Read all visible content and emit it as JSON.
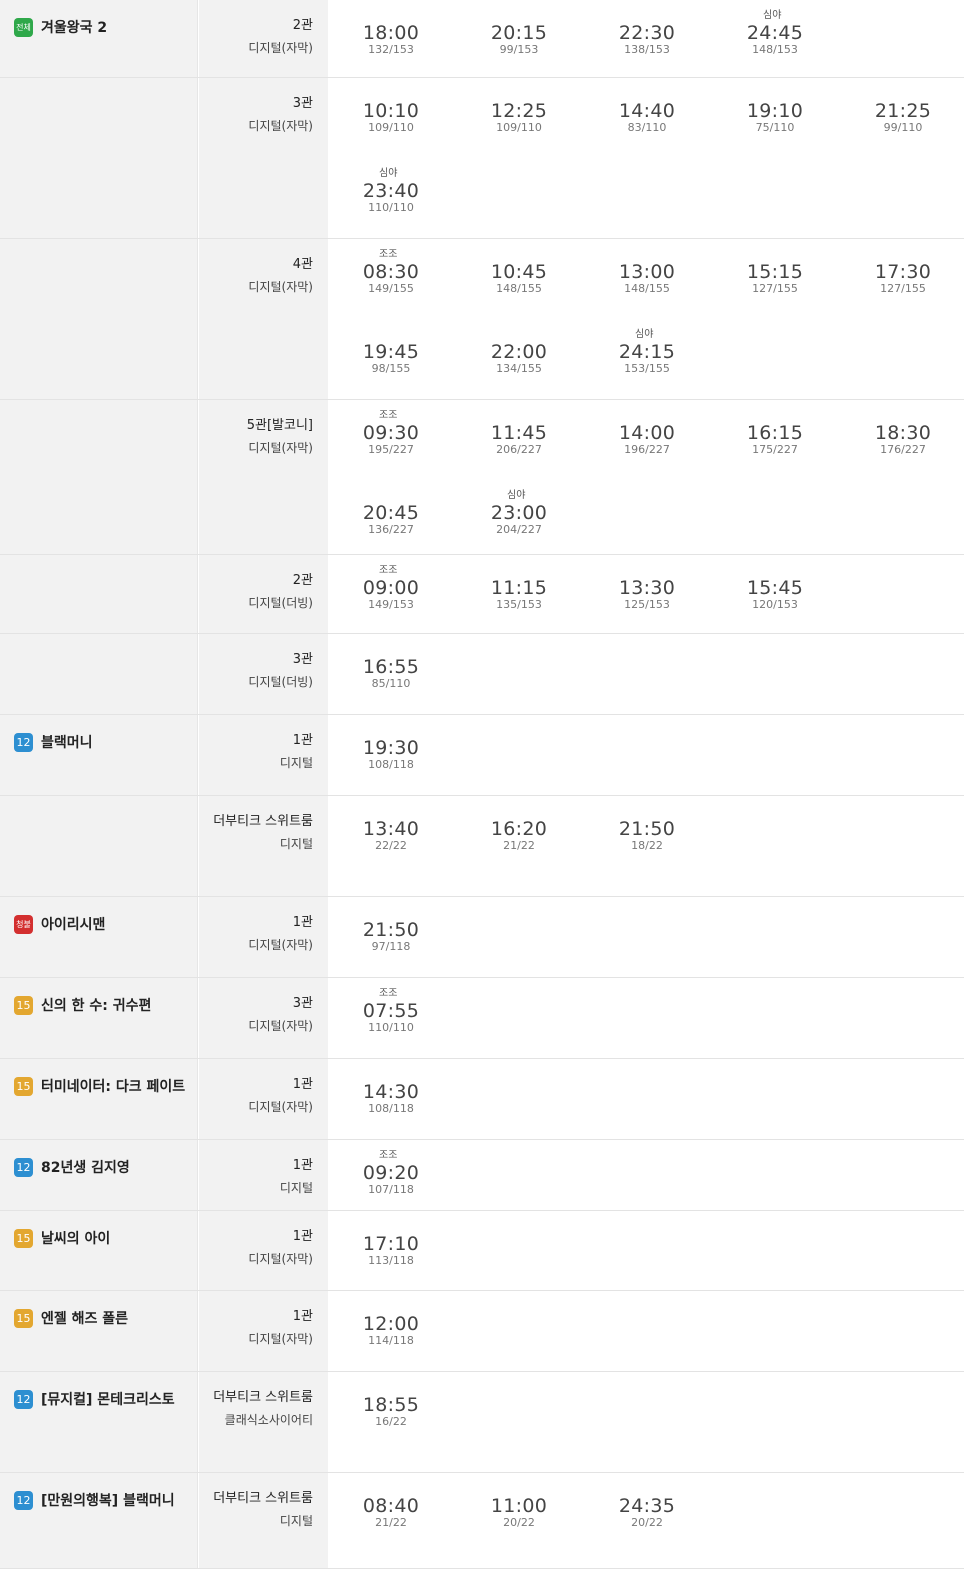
{
  "rows": [
    {
      "movie": "겨울왕국 2",
      "rating": "전체",
      "rating_class": "all",
      "hall": "2관",
      "format": "디지털(자막)",
      "times": [
        {
          "tag": "",
          "time": "18:00",
          "seats": "132/153"
        },
        {
          "tag": "",
          "time": "20:15",
          "seats": "99/153"
        },
        {
          "tag": "",
          "time": "22:30",
          "seats": "138/153"
        },
        {
          "tag": "심야",
          "time": "24:45",
          "seats": "148/153"
        }
      ]
    },
    {
      "movie": "",
      "rating": "",
      "hall": "3관",
      "format": "디지털(자막)",
      "times": [
        {
          "tag": "",
          "time": "10:10",
          "seats": "109/110"
        },
        {
          "tag": "",
          "time": "12:25",
          "seats": "109/110"
        },
        {
          "tag": "",
          "time": "14:40",
          "seats": "83/110"
        },
        {
          "tag": "",
          "time": "19:10",
          "seats": "75/110"
        },
        {
          "tag": "",
          "time": "21:25",
          "seats": "99/110"
        },
        {
          "tag": "심야",
          "time": "23:40",
          "seats": "110/110"
        }
      ]
    },
    {
      "movie": "",
      "rating": "",
      "hall": "4관",
      "format": "디지털(자막)",
      "times": [
        {
          "tag": "조조",
          "time": "08:30",
          "seats": "149/155"
        },
        {
          "tag": "",
          "time": "10:45",
          "seats": "148/155"
        },
        {
          "tag": "",
          "time": "13:00",
          "seats": "148/155"
        },
        {
          "tag": "",
          "time": "15:15",
          "seats": "127/155"
        },
        {
          "tag": "",
          "time": "17:30",
          "seats": "127/155"
        },
        {
          "tag": "",
          "time": "19:45",
          "seats": "98/155"
        },
        {
          "tag": "",
          "time": "22:00",
          "seats": "134/155"
        },
        {
          "tag": "심야",
          "time": "24:15",
          "seats": "153/155"
        }
      ]
    },
    {
      "movie": "",
      "rating": "",
      "hall": "5관[발코니]",
      "format": "디지털(자막)",
      "times": [
        {
          "tag": "조조",
          "time": "09:30",
          "seats": "195/227"
        },
        {
          "tag": "",
          "time": "11:45",
          "seats": "206/227"
        },
        {
          "tag": "",
          "time": "14:00",
          "seats": "196/227"
        },
        {
          "tag": "",
          "time": "16:15",
          "seats": "175/227"
        },
        {
          "tag": "",
          "time": "18:30",
          "seats": "176/227"
        },
        {
          "tag": "",
          "time": "20:45",
          "seats": "136/227"
        },
        {
          "tag": "심야",
          "time": "23:00",
          "seats": "204/227"
        }
      ]
    },
    {
      "movie": "",
      "rating": "",
      "hall": "2관",
      "format": "디지털(더빙)",
      "times": [
        {
          "tag": "조조",
          "time": "09:00",
          "seats": "149/153"
        },
        {
          "tag": "",
          "time": "11:15",
          "seats": "135/153"
        },
        {
          "tag": "",
          "time": "13:30",
          "seats": "125/153"
        },
        {
          "tag": "",
          "time": "15:45",
          "seats": "120/153"
        }
      ]
    },
    {
      "movie": "",
      "rating": "",
      "hall": "3관",
      "format": "디지털(더빙)",
      "times": [
        {
          "tag": "",
          "time": "16:55",
          "seats": "85/110"
        }
      ]
    },
    {
      "movie": "블랙머니",
      "rating": "12",
      "rating_class": "12",
      "hall": "1관",
      "format": "디지털",
      "times": [
        {
          "tag": "",
          "time": "19:30",
          "seats": "108/118"
        }
      ]
    },
    {
      "movie": "",
      "rating": "",
      "hall": "더부티크 스위트룸",
      "format": "디지털",
      "times": [
        {
          "tag": "",
          "time": "13:40",
          "seats": "22/22"
        },
        {
          "tag": "",
          "time": "16:20",
          "seats": "21/22"
        },
        {
          "tag": "",
          "time": "21:50",
          "seats": "18/22"
        }
      ]
    },
    {
      "movie": "아이리시맨",
      "rating": "청불",
      "rating_class": "19",
      "hall": "1관",
      "format": "디지털(자막)",
      "times": [
        {
          "tag": "",
          "time": "21:50",
          "seats": "97/118"
        }
      ]
    },
    {
      "movie": "신의 한 수: 귀수편",
      "rating": "15",
      "rating_class": "15",
      "hall": "3관",
      "format": "디지털(자막)",
      "times": [
        {
          "tag": "조조",
          "time": "07:55",
          "seats": "110/110"
        }
      ]
    },
    {
      "movie": "터미네이터: 다크 페이트",
      "rating": "15",
      "rating_class": "15",
      "hall": "1관",
      "format": "디지털(자막)",
      "times": [
        {
          "tag": "",
          "time": "14:30",
          "seats": "108/118"
        }
      ]
    },
    {
      "movie": "82년생 김지영",
      "rating": "12",
      "rating_class": "12",
      "hall": "1관",
      "format": "디지털",
      "times": [
        {
          "tag": "조조",
          "time": "09:20",
          "seats": "107/118"
        }
      ]
    },
    {
      "movie": "날씨의 아이",
      "rating": "15",
      "rating_class": "15",
      "hall": "1관",
      "format": "디지털(자막)",
      "times": [
        {
          "tag": "",
          "time": "17:10",
          "seats": "113/118"
        }
      ]
    },
    {
      "movie": "엔젤 해즈 폴른",
      "rating": "15",
      "rating_class": "15",
      "hall": "1관",
      "format": "디지털(자막)",
      "times": [
        {
          "tag": "",
          "time": "12:00",
          "seats": "114/118"
        }
      ]
    },
    {
      "movie": "[뮤지컬] 몬테크리스토",
      "rating": "12",
      "rating_class": "12",
      "hall": "더부티크 스위트룸",
      "format": "클래식소사이어티",
      "times": [
        {
          "tag": "",
          "time": "18:55",
          "seats": "16/22"
        }
      ]
    },
    {
      "movie": "[만원의행복] 블랙머니",
      "rating": "12",
      "rating_class": "12",
      "hall": "더부티크 스위트룸",
      "format": "디지털",
      "times": [
        {
          "tag": "",
          "time": "08:40",
          "seats": "21/22"
        },
        {
          "tag": "",
          "time": "11:00",
          "seats": "20/22"
        },
        {
          "tag": "",
          "time": "24:35",
          "seats": "20/22"
        }
      ]
    }
  ]
}
